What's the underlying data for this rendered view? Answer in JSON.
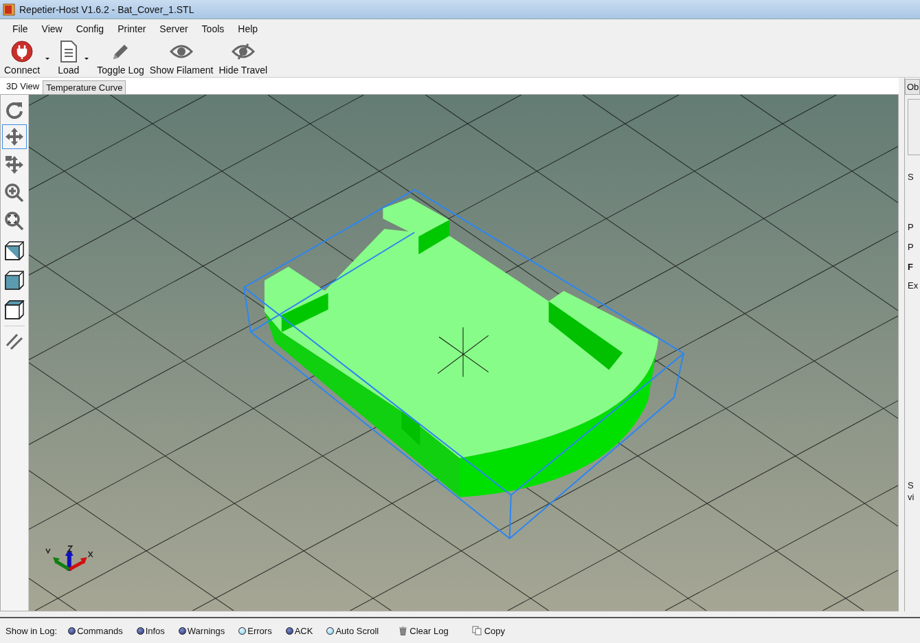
{
  "window": {
    "title": "Repetier-Host V1.6.2 - Bat_Cover_1.STL"
  },
  "menu": [
    "File",
    "View",
    "Config",
    "Printer",
    "Server",
    "Tools",
    "Help"
  ],
  "toolbar": [
    {
      "label": "Connect",
      "kind": "plug",
      "dropdown": true
    },
    {
      "label": "Load",
      "kind": "file",
      "dropdown": true
    },
    {
      "label": "Toggle Log",
      "kind": "pencil",
      "dropdown": false
    },
    {
      "label": "Show Filament",
      "kind": "eye",
      "dropdown": false
    },
    {
      "label": "Hide Travel",
      "kind": "eye-off",
      "dropdown": false
    }
  ],
  "tabs": [
    {
      "label": "3D View",
      "selected": true
    },
    {
      "label": "Temperature Curve",
      "selected": false
    }
  ],
  "view_tools": [
    {
      "kind": "rotate",
      "selected": false
    },
    {
      "kind": "move",
      "selected": true
    },
    {
      "kind": "move-object",
      "selected": false
    },
    {
      "kind": "zoom",
      "selected": false
    },
    {
      "kind": "fit",
      "selected": false
    },
    {
      "kind": "cube-diag",
      "selected": false
    },
    {
      "kind": "cube-front",
      "selected": false
    },
    {
      "kind": "cube-top",
      "selected": false
    },
    {
      "kind": "slash",
      "selected": false
    }
  ],
  "side_panel": {
    "tab": "Ob",
    "labels": [
      {
        "text": "S",
        "bold": false
      },
      {
        "text": "P",
        "bold": false
      },
      {
        "text": "P",
        "bold": false
      },
      {
        "text": "F",
        "bold": true
      },
      {
        "text": "Ex",
        "bold": false
      },
      {
        "text": "S",
        "bold": false
      },
      {
        "text": "vi",
        "bold": false
      }
    ]
  },
  "log_bar": {
    "label": "Show in Log:",
    "toggles": [
      {
        "label": "Commands",
        "on": true
      },
      {
        "label": "Infos",
        "on": true
      },
      {
        "label": "Warnings",
        "on": true
      },
      {
        "label": "Errors",
        "on": false
      },
      {
        "label": "ACK",
        "on": true
      },
      {
        "label": "Auto Scroll",
        "on": false
      }
    ],
    "actions": [
      {
        "label": "Clear Log",
        "kind": "trash"
      },
      {
        "label": "Copy",
        "kind": "copy"
      }
    ]
  }
}
